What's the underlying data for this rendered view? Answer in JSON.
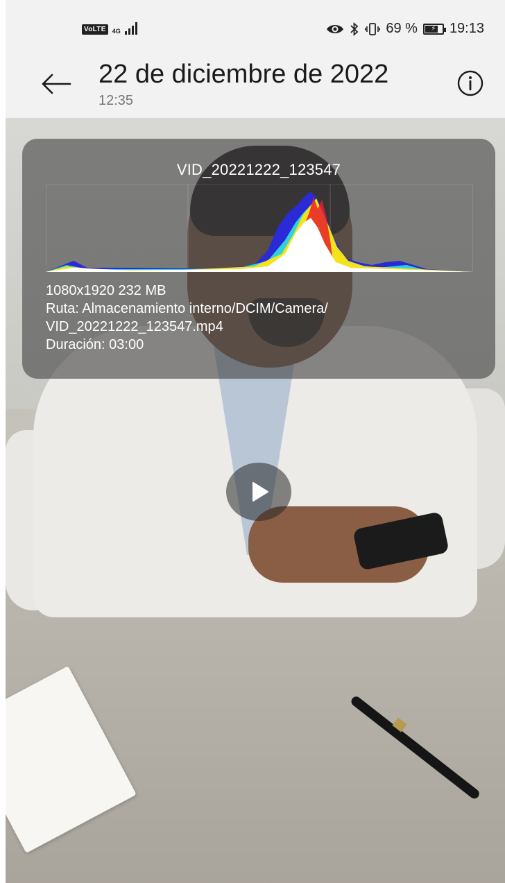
{
  "status_bar": {
    "volte": "VoLTE",
    "network": "4G",
    "battery_percent": "69 %",
    "battery_level": 0.69,
    "time": "19:13",
    "icons": [
      "eye-icon",
      "bluetooth-icon",
      "vibrate-icon",
      "battery-icon"
    ]
  },
  "header": {
    "title": "22 de diciembre de 2022",
    "subtitle": "12:35"
  },
  "overlay": {
    "filename": "VID_20221222_123547",
    "resolution_size": "1080x1920  232 MB",
    "path_line1": "Ruta:  Almacenamiento interno/DCIM/Camera/",
    "path_line2": "VID_20221222_123547.mp4",
    "duration": "Duración:  03:00"
  },
  "colors": {
    "background": "#f2f2f2",
    "overlay": "#464646",
    "histogram_blue": "#2a2ad6",
    "histogram_cyan": "#2fd0e0",
    "histogram_yellow": "#f4e31a",
    "histogram_red": "#e8202a",
    "histogram_white": "#ffffff"
  },
  "video": {
    "play_icon": "play-icon"
  }
}
